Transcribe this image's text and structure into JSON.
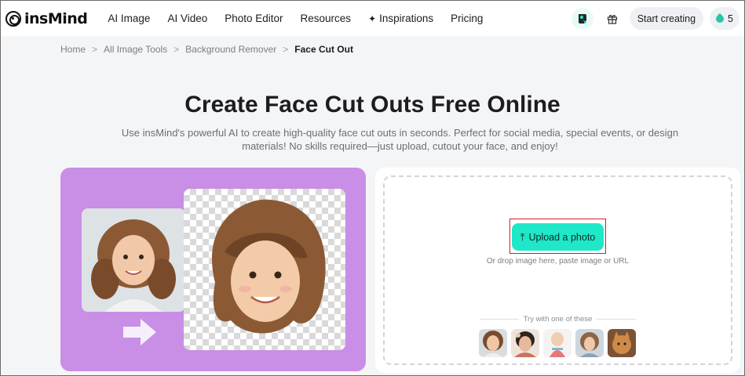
{
  "header": {
    "logo_text": "insMind",
    "nav": [
      "AI Image",
      "AI Video",
      "Photo Editor",
      "Resources",
      "Inspirations",
      "Pricing"
    ],
    "start_label": "Start creating",
    "credits": "5"
  },
  "breadcrumb": [
    "Home",
    "All Image Tools",
    "Background Remover",
    "Face Cut Out"
  ],
  "hero": {
    "title": "Create Face Cut Outs Free Online",
    "description": "Use insMind's powerful AI to create high-quality face cut outs in seconds. Perfect for social media, special events, or design materials! No skills required—just upload, cutout your face, and enjoy!"
  },
  "upload": {
    "button_label": "Upload a photo",
    "hint": "Or drop image here, paste image or URL",
    "try_label": "Try with one of these"
  },
  "colors": {
    "accent": "#1ee8c8",
    "demo_bg": "#c98ee6",
    "highlight": "#d21d2c"
  },
  "icons": {
    "logo": "insmind-logo-icon",
    "inspirations": "sparkle-icon",
    "app": "ai-avatar-icon",
    "gift": "gift-icon",
    "credits": "credit-drop-icon",
    "upload": "upload-arrow-icon"
  }
}
